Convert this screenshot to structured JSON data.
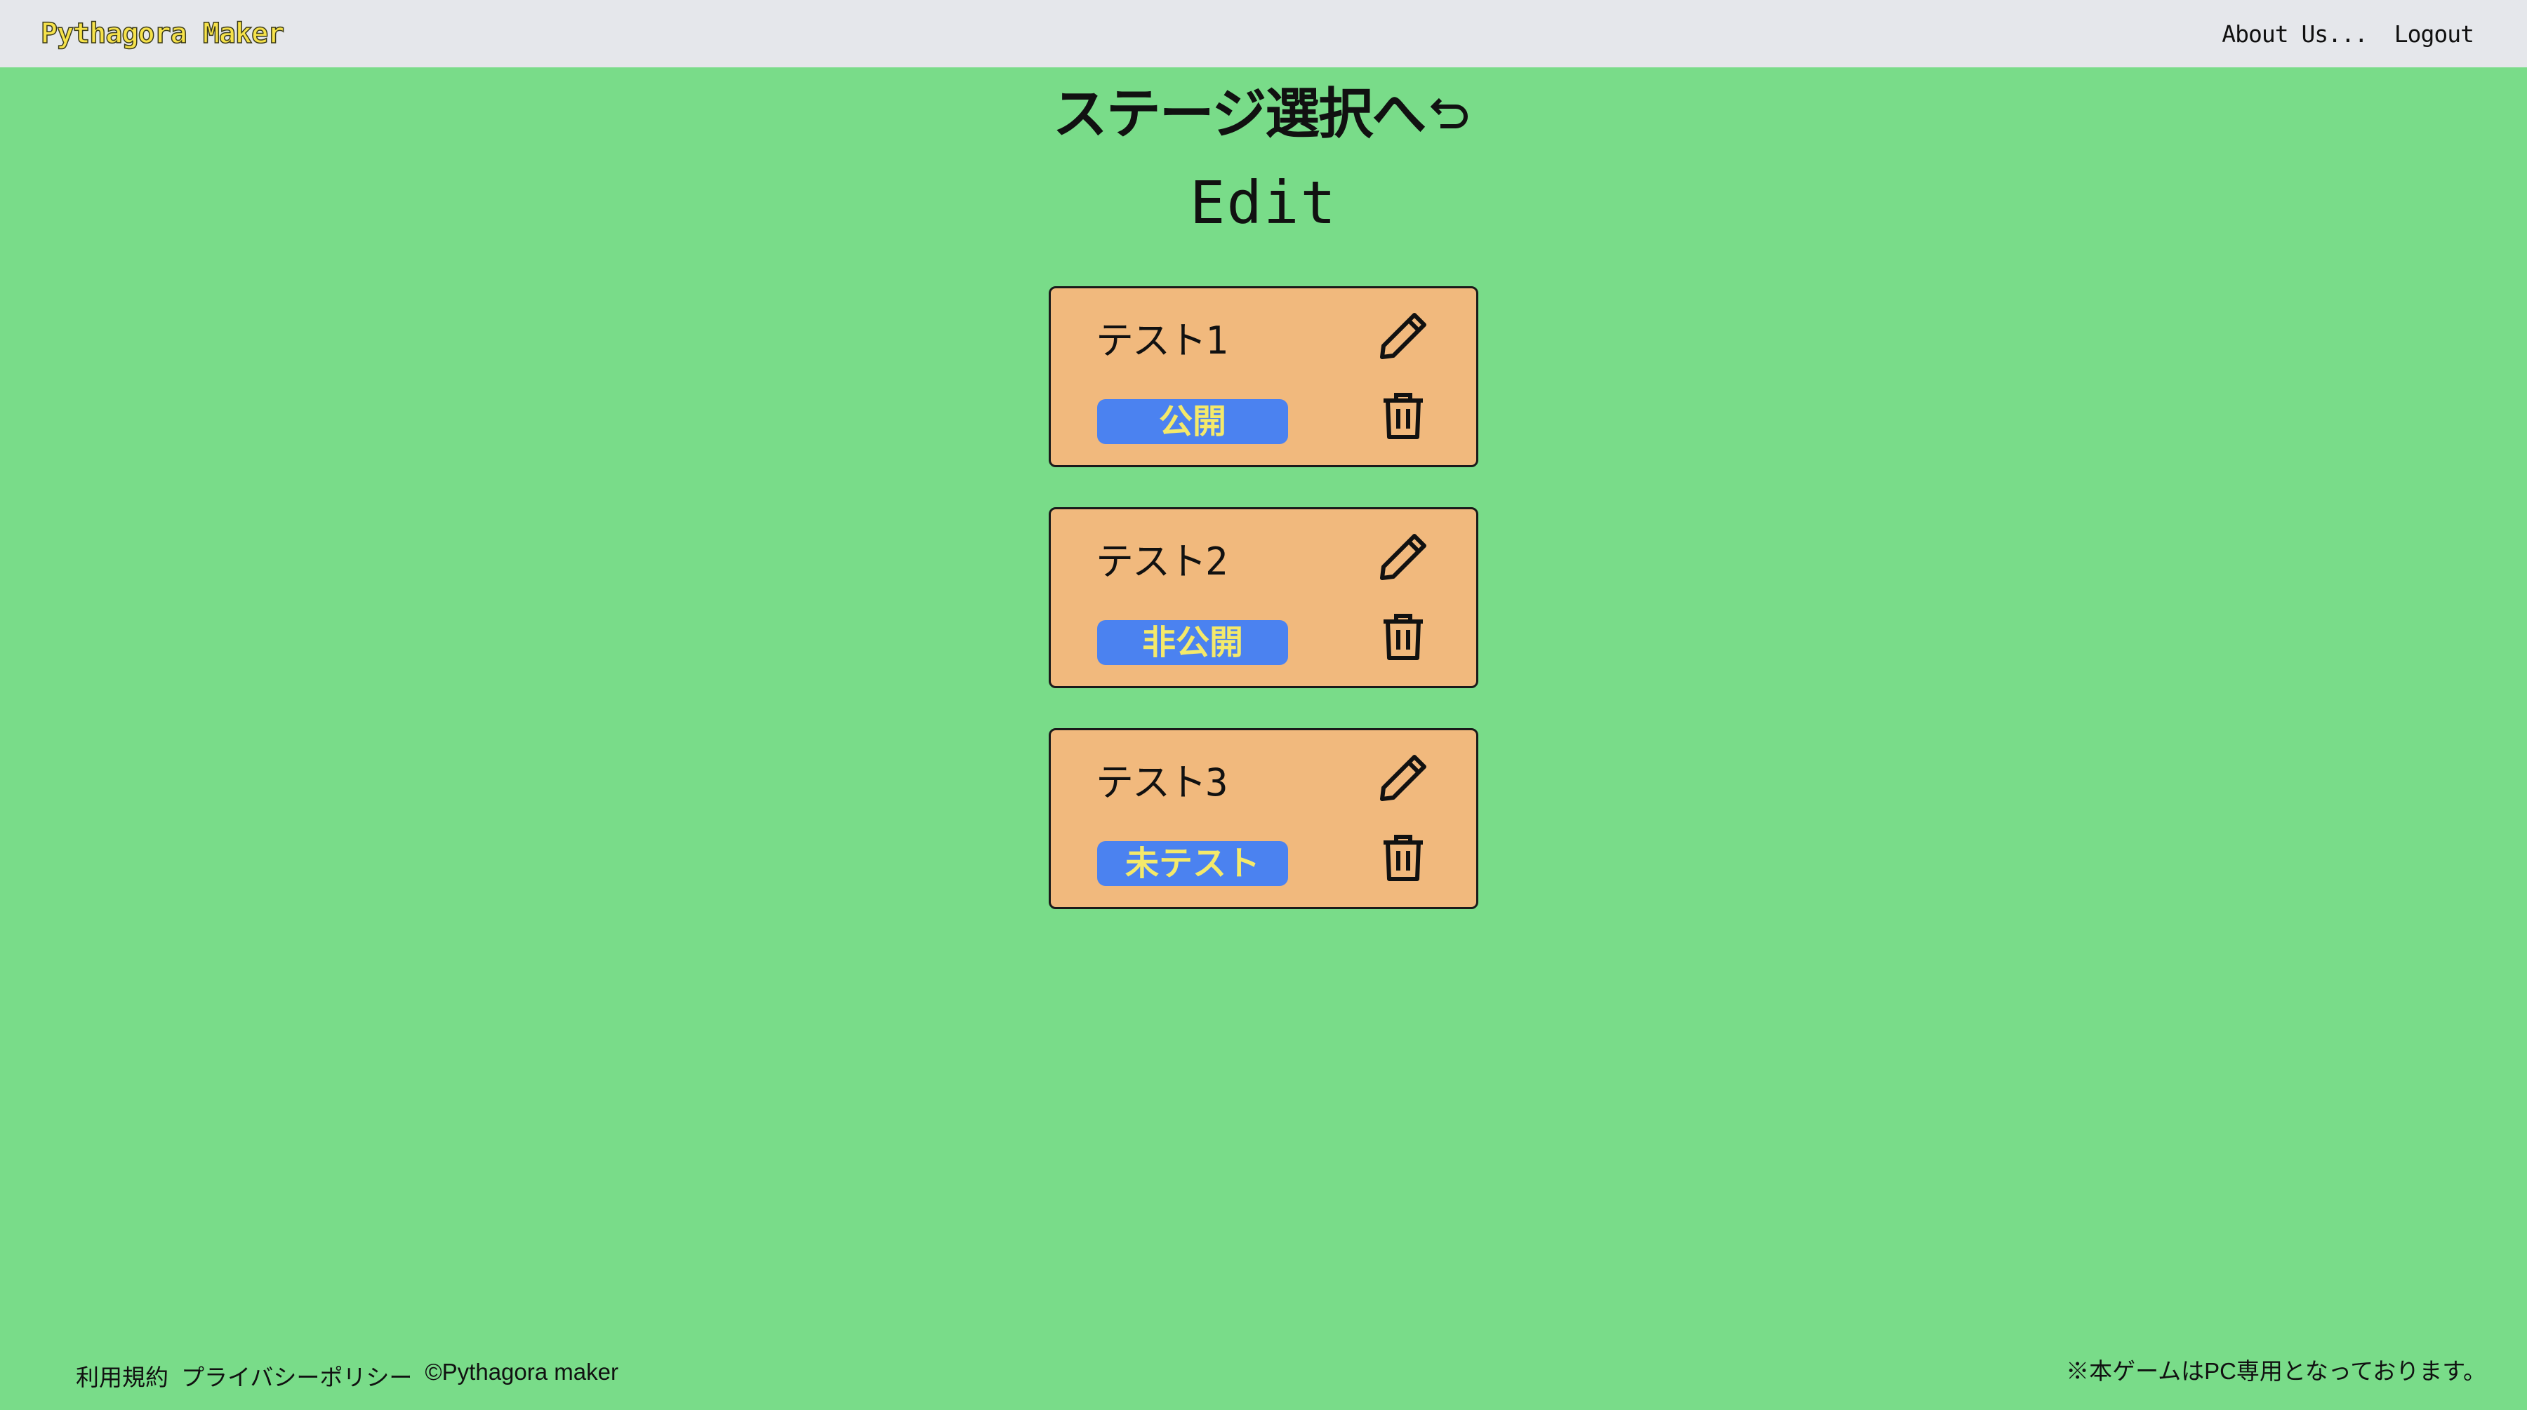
{
  "header": {
    "brand": "Pythagora Maker",
    "links": [
      {
        "label": "About Us..."
      },
      {
        "label": "Logout"
      }
    ]
  },
  "back_link": {
    "label": "ステージ選択へ",
    "icon": "return-arrow-icon"
  },
  "page_title": "Edit",
  "stages": [
    {
      "name": "テスト1",
      "status": "公開",
      "edit_icon": "pencil-icon",
      "delete_icon": "trash-icon"
    },
    {
      "name": "テスト2",
      "status": "非公開",
      "edit_icon": "pencil-icon",
      "delete_icon": "trash-icon"
    },
    {
      "name": "テスト3",
      "status": "未テスト",
      "edit_icon": "pencil-icon",
      "delete_icon": "trash-icon"
    }
  ],
  "footer": {
    "terms": "利用規約",
    "privacy": "プライバシーポリシー",
    "copyright": "©Pythagora maker",
    "notice": "※本ゲームはPC専用となっております。"
  },
  "colors": {
    "background": "#79dc89",
    "header_bg": "#e5e7eb",
    "card_bg": "#f1b97d",
    "badge_bg": "#4b82f0",
    "badge_text": "#f4e96a",
    "brand_text": "#f6e24a"
  }
}
